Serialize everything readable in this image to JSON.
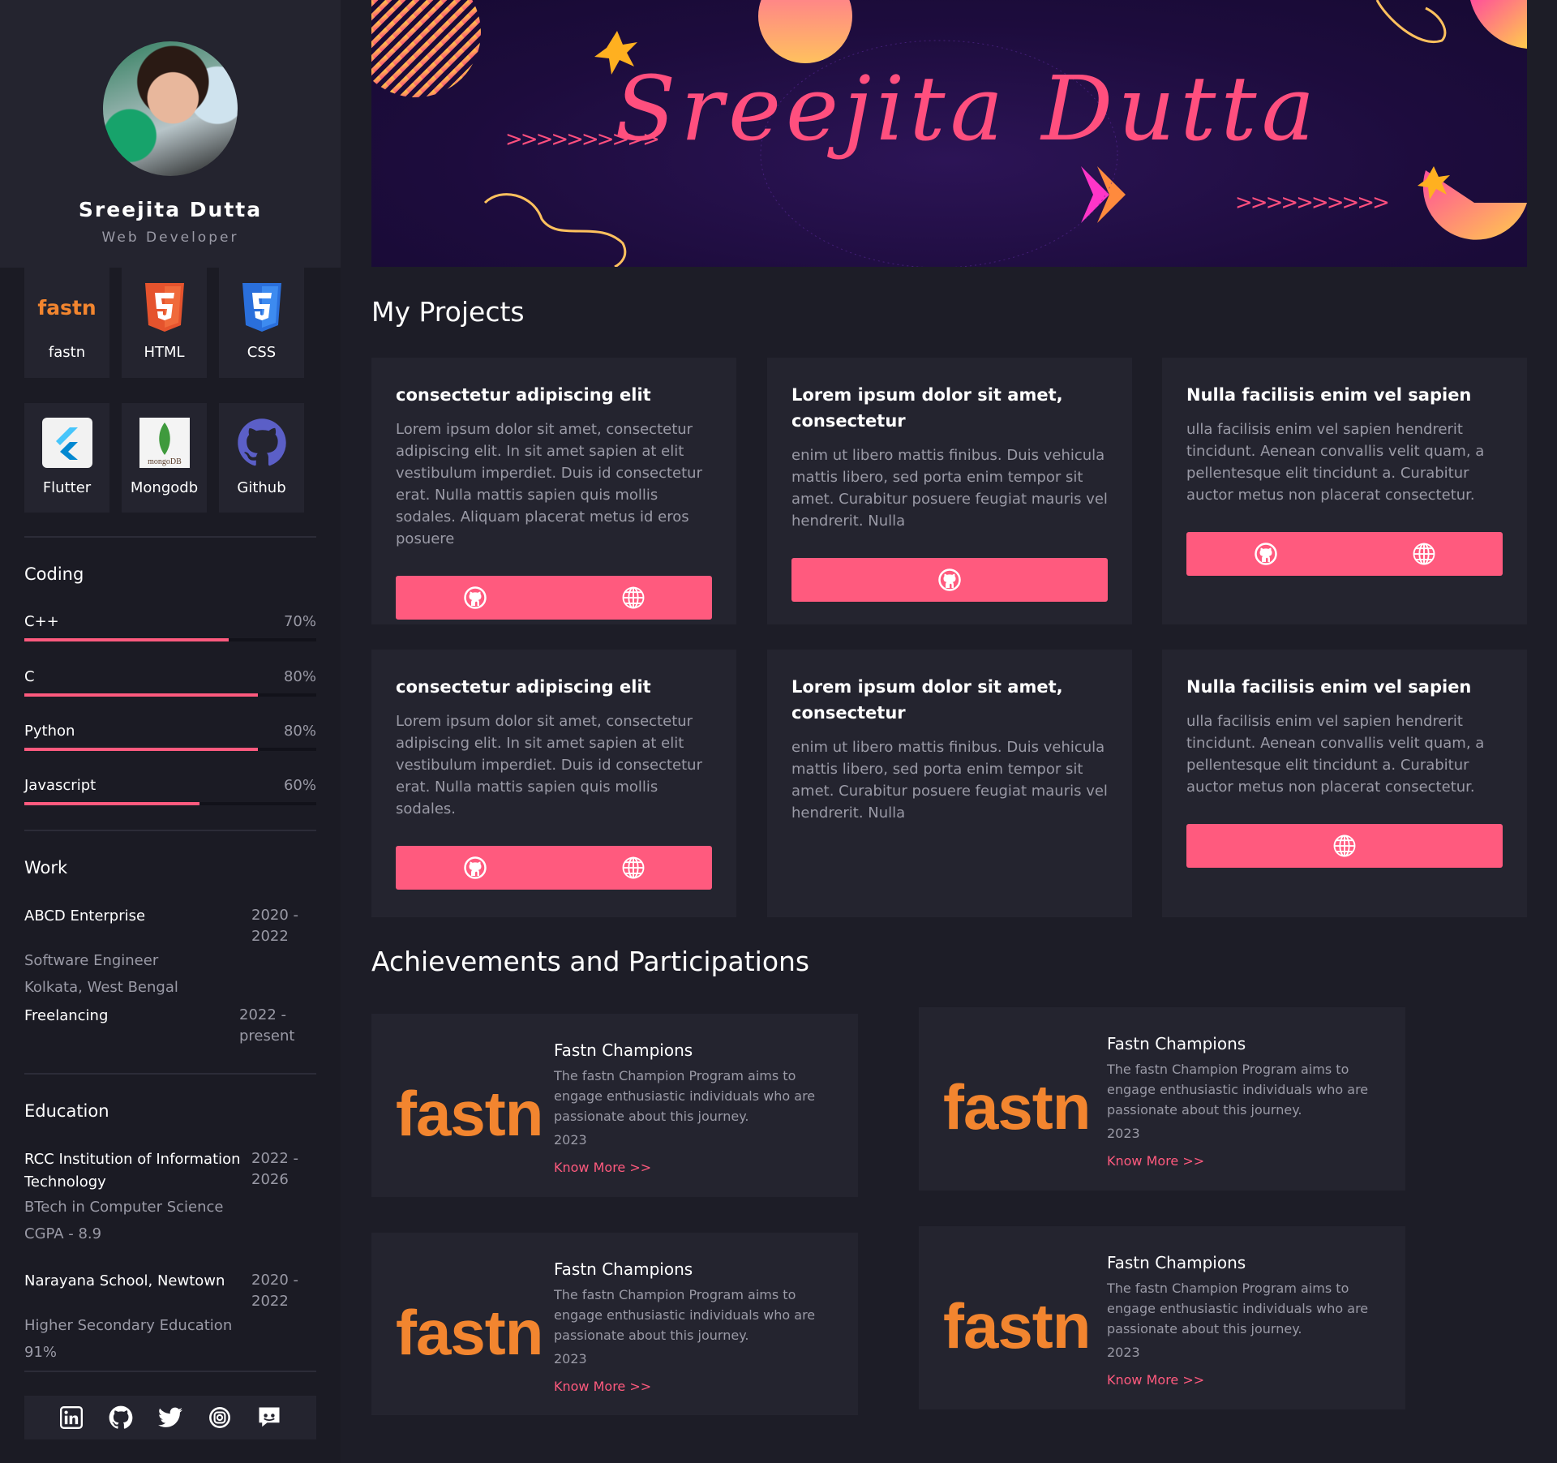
{
  "profile": {
    "name": "Sreejita Dutta",
    "role": "Web Developer"
  },
  "skills": [
    {
      "label": "fastn",
      "icon": "fastn-icon",
      "logo_text": "fastn"
    },
    {
      "label": "HTML",
      "icon": "html5-icon"
    },
    {
      "label": "CSS",
      "icon": "css3-icon"
    },
    {
      "label": "Flutter",
      "icon": "flutter-icon"
    },
    {
      "label": "Mongodb",
      "icon": "mongodb-icon",
      "logo_text": "mongoDB"
    },
    {
      "label": "Github",
      "icon": "github-icon"
    }
  ],
  "coding": {
    "title": "Coding",
    "items": [
      {
        "name": "C++",
        "percent_label": "70%",
        "level": 0.7
      },
      {
        "name": "C",
        "percent_label": "80%",
        "level": 0.8
      },
      {
        "name": "Python",
        "percent_label": "80%",
        "level": 0.8
      },
      {
        "name": "Javascript",
        "percent_label": "60%",
        "level": 0.6
      }
    ]
  },
  "work": {
    "title": "Work",
    "items": [
      {
        "title": "ABCD Enterprise",
        "years": "2020 - 2022",
        "lines": [
          "Software Engineer",
          "Kolkata, West Bengal"
        ]
      },
      {
        "title": "Freelancing",
        "years": "2022 - present",
        "lines": []
      }
    ]
  },
  "education": {
    "title": "Education",
    "items": [
      {
        "title": "RCC Institution of Information Technology",
        "years": "2022 - 2026",
        "lines": [
          "BTech in Computer Science",
          "CGPA - 8.9"
        ]
      },
      {
        "title": "Narayana School, Newtown",
        "years": "2020 - 2022",
        "lines": [
          "Higher Secondary Education",
          "91%"
        ]
      }
    ]
  },
  "socials": [
    "linkedin-icon",
    "github-icon",
    "twitter-icon",
    "instagram-icon",
    "discord-icon"
  ],
  "hero": {
    "signature": "Sreejita Dutta"
  },
  "projects_title": "My Projects",
  "projects": [
    {
      "title": "consectetur adipiscing elit",
      "desc": "Lorem ipsum dolor sit amet, consectetur adipiscing elit. In sit amet sapien at elit vestibulum imperdiet. Duis id consectetur erat. Nulla mattis sapien quis mollis sodales. Aliquam placerat metus id eros posuere",
      "links": [
        "github",
        "web"
      ]
    },
    {
      "title": "Lorem ipsum dolor sit amet, consectetur",
      "desc": "enim ut libero mattis finibus. Duis vehicula mattis libero, sed porta enim tempor sit amet. Curabitur posuere feugiat mauris vel hendrerit. Nulla",
      "links": [
        "github"
      ]
    },
    {
      "title": "Nulla facilisis enim vel sapien",
      "desc": "ulla facilisis enim vel sapien hendrerit tincidunt. Aenean convallis velit quam, a pellentesque elit tincidunt a. Curabitur auctor metus non placerat consectetur.",
      "links": [
        "github",
        "web"
      ]
    },
    {
      "title": "consectetur adipiscing elit",
      "desc": "Lorem ipsum dolor sit amet, consectetur adipiscing elit. In sit amet sapien at elit vestibulum imperdiet. Duis id consectetur erat. Nulla mattis sapien quis mollis sodales.",
      "links": [
        "github",
        "web"
      ]
    },
    {
      "title": "Lorem ipsum dolor sit amet, consectetur",
      "desc": "enim ut libero mattis finibus. Duis vehicula mattis libero, sed porta enim tempor sit amet. Curabitur posuere feugiat mauris vel hendrerit. Nulla",
      "links": []
    },
    {
      "title": "Nulla facilisis enim vel sapien",
      "desc": "ulla facilisis enim vel sapien hendrerit tincidunt. Aenean convallis velit quam, a pellentesque elit tincidunt a. Curabitur auctor metus non placerat consectetur.",
      "links": [
        "web"
      ]
    }
  ],
  "achievements_title": "Achievements and Participations",
  "achievements": [
    {
      "logo": "fastn",
      "title": "Fastn Champions",
      "desc": "The fastn Champion Program aims to engage enthusiastic individuals who are passionate about this journey.",
      "year": "2023",
      "link": "Know More >>"
    },
    {
      "logo": "fastn",
      "title": "Fastn Champions",
      "desc": "The fastn Champion Program aims to engage enthusiastic individuals who are passionate about this journey.",
      "year": "2023",
      "link": "Know More >>"
    },
    {
      "logo": "fastn",
      "title": "Fastn Champions",
      "desc": "The fastn Champion Program aims to engage enthusiastic individuals who are passionate about this journey.",
      "year": "2023",
      "link": "Know More >>"
    },
    {
      "logo": "fastn",
      "title": "Fastn Champions",
      "desc": "The fastn Champion Program aims to engage enthusiastic individuals who are passionate about this journey.",
      "year": "2023",
      "link": "Know More >>"
    }
  ],
  "colors": {
    "accent": "#ff5a7e",
    "fastn_orange": "#f2852f",
    "panel": "#24242f",
    "background": "#1d1d27"
  }
}
